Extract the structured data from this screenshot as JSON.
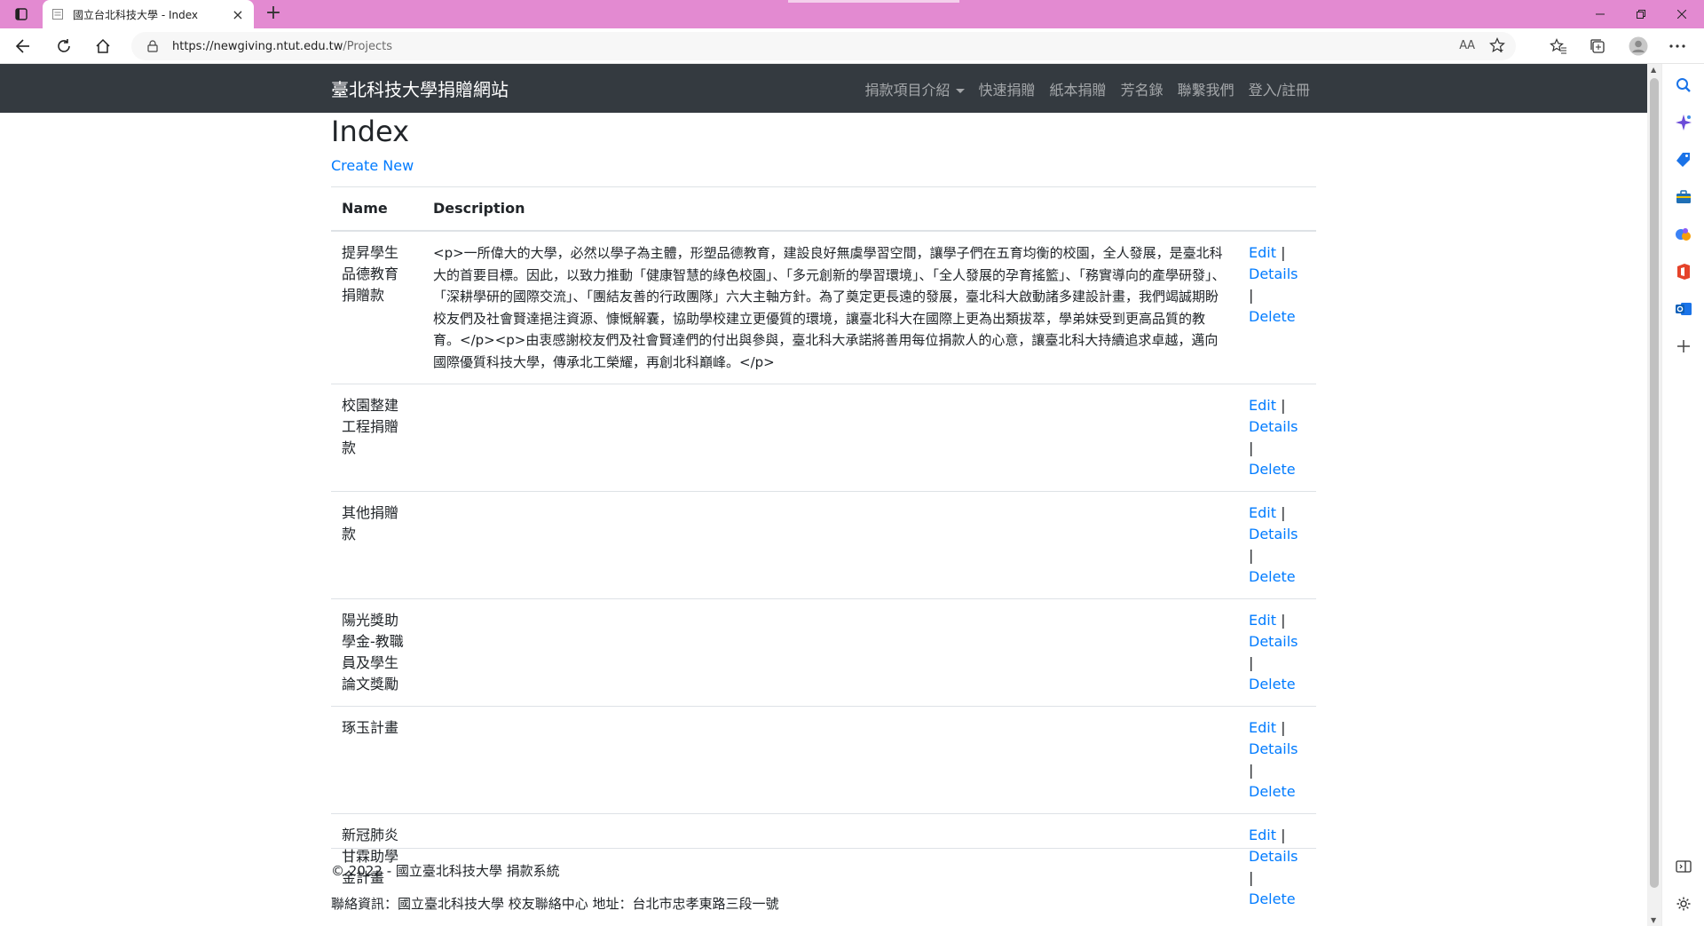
{
  "browser": {
    "tab_title": "國立台北科技大學 - Index",
    "new_tab": "+",
    "url_host": "https://newgiving.ntut.edu.tw",
    "url_path": "/Projects",
    "read_aloud": "AΑ"
  },
  "site": {
    "brand": "臺北科技大學捐贈網站",
    "nav": [
      "捐款項目介紹",
      "快速捐贈",
      "紙本捐贈",
      "芳名錄",
      "聯繫我們",
      "登入/註冊"
    ]
  },
  "page": {
    "title": "Index",
    "create_link": "Create New",
    "table": {
      "headers": [
        "Name",
        "Description"
      ],
      "action_labels": {
        "edit": "Edit",
        "details": "Details",
        "delete": "Delete",
        "separator": "|"
      },
      "rows": [
        {
          "name": "提昇學生品德教育捐贈款",
          "description": "<p>一所偉大的大學，必然以學子為主體，形塑品德教育，建設良好無虞學習空間，讓學子們在五育均衡的校園，全人發展，是臺北科大的首要目標。因此，以致力推動「健康智慧的綠色校園」、「多元創新的學習環境」、「全人發展的孕育搖籃」、「務實導向的產學研發」、「深耕學研的國際交流」、「團結友善的行政團隊」六大主軸方針。為了奠定更長遠的發展，臺北科大啟動諸多建設計畫，我們竭誠期盼校友們及社會賢達挹注資源、慷慨解囊，協助學校建立更優質的環境，讓臺北科大在國際上更為出類拔萃，學弟妹受到更高品質的教育。</p><p>由衷感謝校友們及社會賢達們的付出與參與，臺北科大承諾將善用每位捐款人的心意，讓臺北科大持續追求卓越，邁向國際優質科技大學，傳承北工榮耀，再創北科巔峰。</p>"
        },
        {
          "name": "校園整建工程捐贈款",
          "description": ""
        },
        {
          "name": "其他捐贈款",
          "description": ""
        },
        {
          "name": "陽光獎助學金-教職員及學生論文獎勵",
          "description": ""
        },
        {
          "name": "琢玉計畫",
          "description": ""
        },
        {
          "name": "新冠肺炎甘霖助學金計畫",
          "description": ""
        }
      ]
    }
  },
  "footer": {
    "copyright": "© 2022 - 國立臺北科技大學 捐款系統",
    "contact": "聯絡資訊：國立臺北科技大學 校友聯絡中心 地址：台北市忠孝東路三段一號"
  },
  "colors": {
    "tabbar": "#e38ad1",
    "navbar": "#343a40",
    "link": "#007bff"
  }
}
